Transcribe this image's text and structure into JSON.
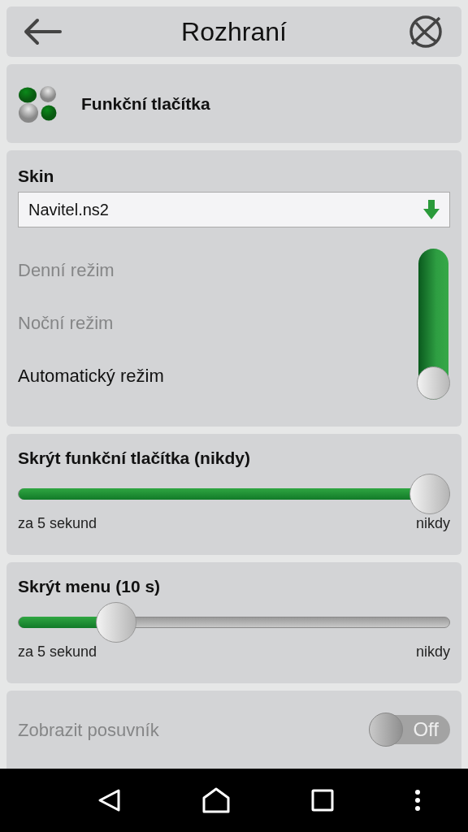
{
  "header": {
    "title": "Rozhraní"
  },
  "function_buttons": {
    "label": "Funkční tlačítka"
  },
  "skin": {
    "heading": "Skin",
    "value": "Navitel.ns2",
    "modes": [
      {
        "label": "Denní režim",
        "selected": false
      },
      {
        "label": "Noční režim",
        "selected": false
      },
      {
        "label": "Automatický režim",
        "selected": true
      }
    ]
  },
  "sliders": [
    {
      "title": "Skrýt funkční tlačítka (nikdy)",
      "level": 1.0,
      "min_label": "za 5 sekund",
      "max_label": "nikdy"
    },
    {
      "title": "Skrýt menu (10 s)",
      "level": 0.2,
      "min_label": "za 5 sekund",
      "max_label": "nikdy"
    }
  ],
  "scrollbar_setting": {
    "label": "Zobrazit posuvník",
    "disabled": true,
    "on": false,
    "switch_label": "Off"
  }
}
